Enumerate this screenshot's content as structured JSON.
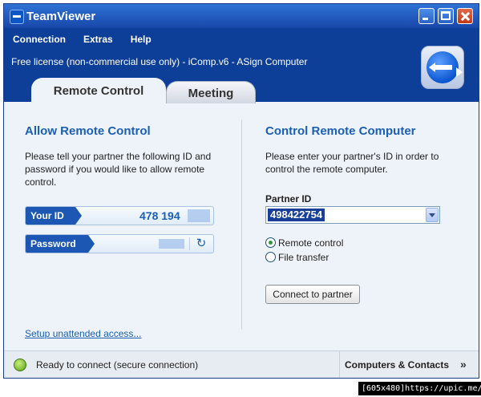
{
  "window": {
    "title": "TeamViewer"
  },
  "menu": [
    "Connection",
    "Extras",
    "Help"
  ],
  "license_text": "Free license (non-commercial use only) - iComp.v6 - ASign Computer",
  "tabs": [
    {
      "label": "Remote Control",
      "active": true
    },
    {
      "label": "Meeting",
      "active": false
    }
  ],
  "allow": {
    "title": "Allow Remote Control",
    "description": "Please tell your partner the following ID and password if you would like to allow remote control.",
    "your_id_label": "Your ID",
    "your_id_value": "478 194",
    "password_label": "Password",
    "refresh_icon": "refresh-icon",
    "setup_link": "Setup unattended access..."
  },
  "control": {
    "title": "Control Remote Computer",
    "description": "Please enter your partner's ID in order to control the remote computer.",
    "partner_id_label": "Partner ID",
    "partner_id_value": "498422754",
    "radio_remote": "Remote control",
    "radio_file": "File transfer",
    "selected_mode": "Remote control",
    "connect_button": "Connect to partner"
  },
  "status": {
    "text": "Ready to connect (secure connection)",
    "indicator_color": "#5aa11a",
    "computers_contacts": "Computers & Contacts",
    "chevron": "»"
  },
  "footer_tag": "[605x480]https://upic.me/",
  "colors": {
    "header": "#0d3e98",
    "accent": "#1a5fb4",
    "titlebar": "#1747a8"
  }
}
